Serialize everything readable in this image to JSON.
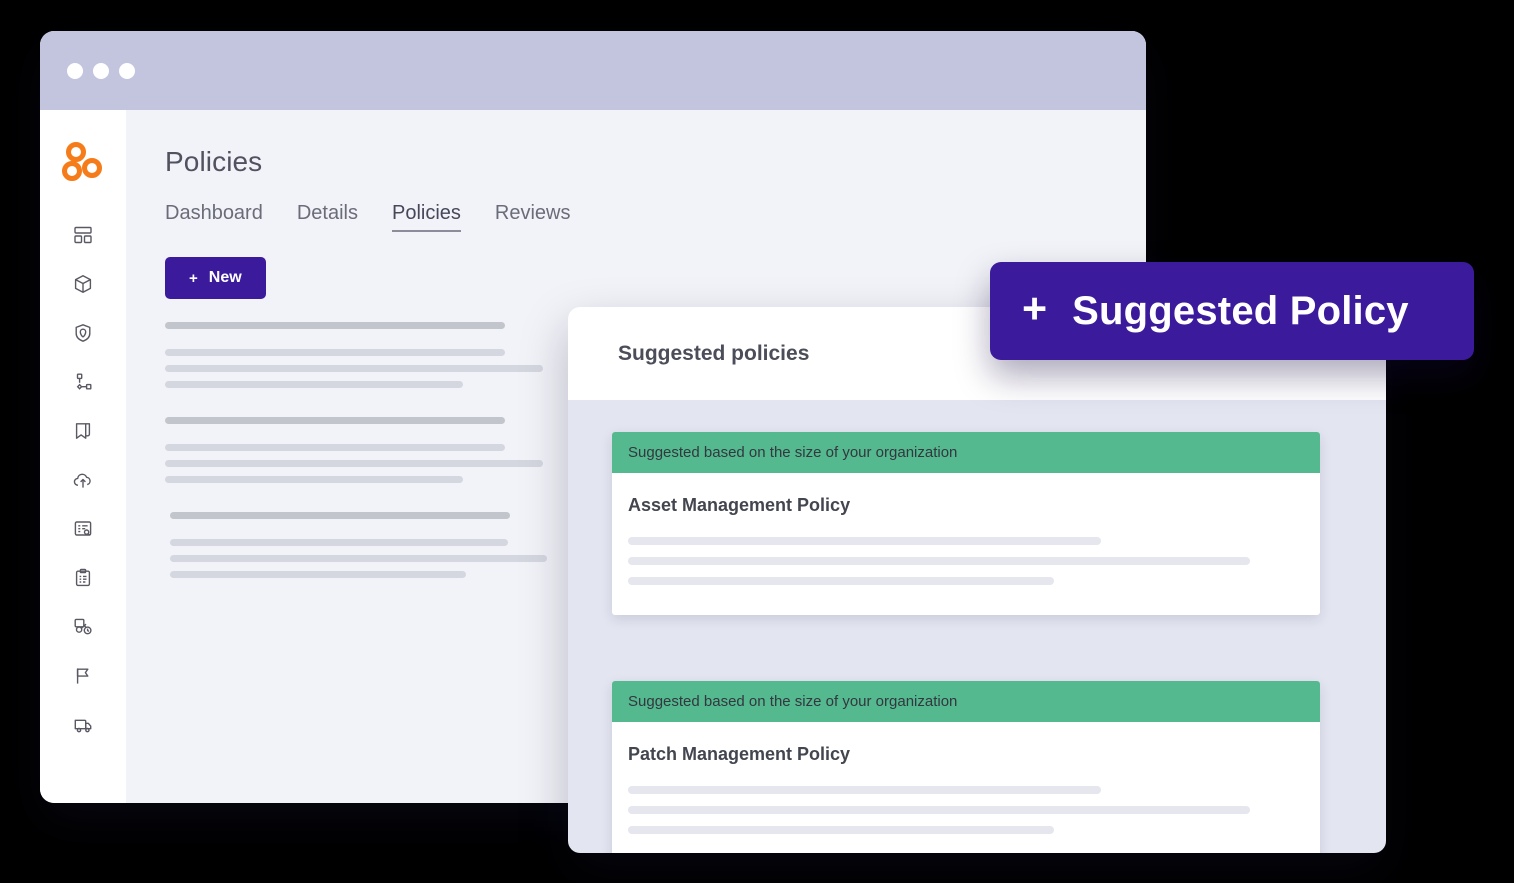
{
  "window": {
    "traffic_lights": [
      "close",
      "minimize",
      "maximize"
    ]
  },
  "sidebar": {
    "logo_name": "app-logo",
    "logo_color": "#f57c18",
    "items": [
      {
        "icon": "dashboard-layout-icon"
      },
      {
        "icon": "package-box-icon"
      },
      {
        "icon": "shield-check-icon"
      },
      {
        "icon": "workflow-nodes-icon"
      },
      {
        "icon": "bookmark-icon"
      },
      {
        "icon": "cloud-upload-icon"
      },
      {
        "icon": "document-search-icon"
      },
      {
        "icon": "clipboard-list-icon"
      },
      {
        "icon": "key-settings-icon"
      },
      {
        "icon": "flag-icon"
      },
      {
        "icon": "truck-icon"
      }
    ]
  },
  "main": {
    "title": "Policies",
    "tabs": [
      {
        "label": "Dashboard",
        "active": false
      },
      {
        "label": "Details",
        "active": false
      },
      {
        "label": "Policies",
        "active": true
      },
      {
        "label": "Reviews",
        "active": false
      }
    ],
    "new_button": {
      "plus": "+",
      "label": "New"
    },
    "skeleton_groups": [
      {
        "head_width": "88%",
        "lines": [
          "88%",
          "100%",
          "77%"
        ]
      },
      {
        "head_width": "88%",
        "lines": [
          "88%",
          "100%",
          "77%"
        ]
      },
      {
        "head_width": "87%",
        "lines": [
          "87%",
          "99%",
          "76%"
        ]
      }
    ]
  },
  "panel": {
    "title": "Suggested policies",
    "banner_color": "#55b98f",
    "cards": [
      {
        "banner": "Suggested based on the size of your organization",
        "name": "Asset Management Policy",
        "skeleton_lines": [
          "70%",
          "92%",
          "63%"
        ]
      },
      {
        "banner": "Suggested based on the size of your organization",
        "name": "Patch Management Policy",
        "skeleton_lines": [
          "70%",
          "92%",
          "63%"
        ]
      }
    ]
  },
  "badge": {
    "plus": "+",
    "label": "Suggested Policy",
    "color": "#3b1b9c"
  }
}
